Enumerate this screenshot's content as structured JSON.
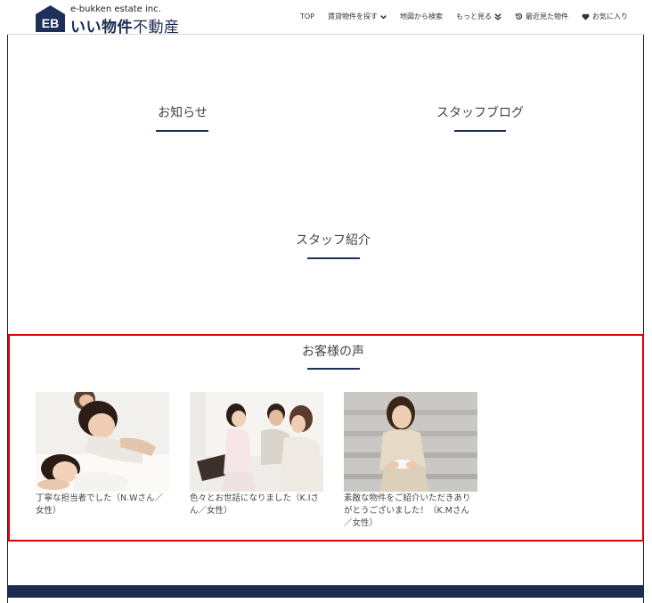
{
  "header": {
    "logo_mark": "EB",
    "logo_sub": "e-bukken estate inc.",
    "logo_main_bold": "いい物件",
    "logo_main_thin": "不動産",
    "nav": {
      "top": "TOP",
      "rent_search": "賃貸物件を探す",
      "map_search": "地図から検索",
      "more": "もっと見る",
      "recently_viewed": "最近見た物件",
      "favorites": "お気に入り"
    }
  },
  "sections": {
    "news": "お知らせ",
    "staff_blog": "スタッフブログ",
    "staff_intro": "スタッフ紹介",
    "testimonials": "お客様の声"
  },
  "testimonials": [
    {
      "text": "丁寧な担当者でした（N.Wさん／女性）"
    },
    {
      "text": "色々とお世話になりました（K.Iさん／女性）"
    },
    {
      "text": "素敵な物件をご紹介いただきありがとうございました！（K.Mさん／女性）"
    }
  ],
  "colors": {
    "brand_navy": "#1e2f5a",
    "highlight_red": "#e00000",
    "footer_navy": "#1c2a4d"
  }
}
